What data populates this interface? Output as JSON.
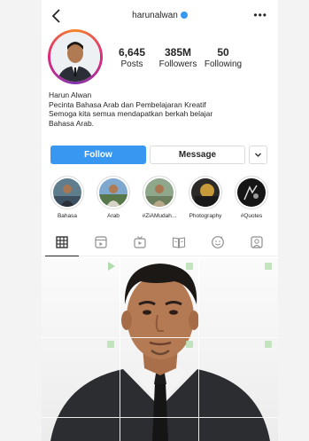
{
  "header": {
    "username": "harunalwan",
    "back_icon": "chevron-left-icon",
    "more_icon": "more-horizontal-icon",
    "more_label": "•••",
    "verified_color": "#3897f0"
  },
  "stats": {
    "posts": {
      "value": "6,645",
      "label": "Posts"
    },
    "followers": {
      "value": "385M",
      "label": "Followers"
    },
    "following": {
      "value": "50",
      "label": "Following"
    }
  },
  "bio": {
    "name": "Harun Alwan",
    "lines": [
      "Pecinta Bahasa Arab dan Pembelajaran Kreatif",
      "Semoga kita semua mendapatkan berkah belajar",
      "Bahasa Arab."
    ]
  },
  "actions": {
    "follow": "Follow",
    "message": "Message",
    "dropdown_icon": "chevron-down-icon"
  },
  "highlights": [
    {
      "label": "Bahasa"
    },
    {
      "label": "Arab"
    },
    {
      "label": "#ZiAMudah..."
    },
    {
      "label": "Photography"
    },
    {
      "label": "#Quotes"
    }
  ],
  "tabs": [
    {
      "icon": "grid-icon",
      "active": true
    },
    {
      "icon": "reels-icon",
      "active": false
    },
    {
      "icon": "tv-icon",
      "active": false
    },
    {
      "icon": "guide-book-icon",
      "active": false
    },
    {
      "icon": "smiley-icon",
      "active": false
    },
    {
      "icon": "tagged-person-icon",
      "active": false
    }
  ],
  "colors": {
    "accent": "#3897f0",
    "text": "#262626",
    "border": "#dbdbdb"
  }
}
